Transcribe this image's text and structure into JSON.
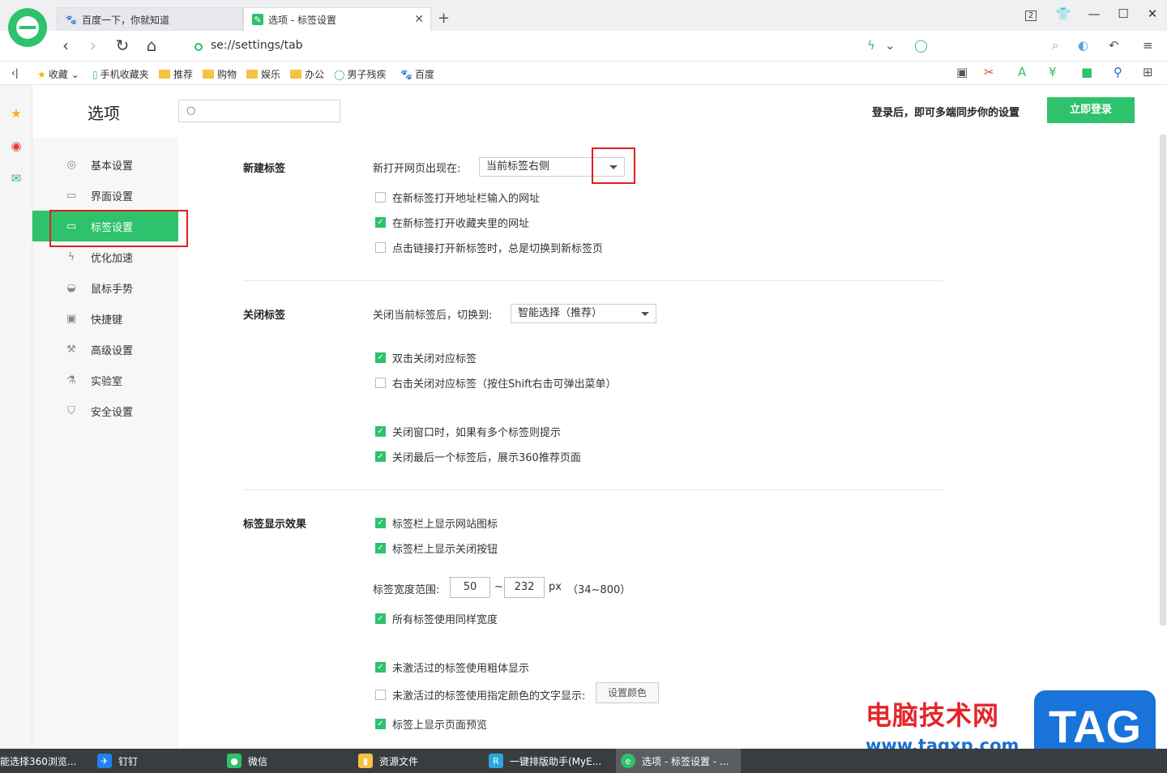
{
  "browser": {
    "tabs": [
      {
        "label": "百度一下，你就知道"
      },
      {
        "label": "选项 - 标签设置"
      }
    ],
    "tab_count": "2",
    "url": "se://settings/tab"
  },
  "bookmarks": {
    "items": [
      "收藏",
      "手机收藏夹",
      "推荐",
      "购物",
      "娱乐",
      "办公",
      "男子残疾",
      "百度"
    ]
  },
  "settings": {
    "title": "选项",
    "search_placeholder": "",
    "login_hint": "登录后，即可多端同步你的设置",
    "login_button": "立即登录",
    "nav": [
      {
        "label": "基本设置",
        "icon": "gear-icon"
      },
      {
        "label": "界面设置",
        "icon": "window-icon"
      },
      {
        "label": "标签设置",
        "icon": "tab-icon"
      },
      {
        "label": "优化加速",
        "icon": "lightning-icon"
      },
      {
        "label": "鼠标手势",
        "icon": "mouse-icon"
      },
      {
        "label": "快捷键",
        "icon": "keyboard-icon"
      },
      {
        "label": "高级设置",
        "icon": "wrench-icon"
      },
      {
        "label": "实验室",
        "icon": "flask-icon"
      },
      {
        "label": "安全设置",
        "icon": "shield-icon"
      }
    ],
    "active_nav": "标签设置",
    "new_tab": {
      "title": "新建标签",
      "open_label": "新打开网页出现在:",
      "open_value": "当前标签右侧",
      "options": [
        {
          "label": "在新标签打开地址栏输入的网址",
          "checked": false
        },
        {
          "label": "在新标签打开收藏夹里的网址",
          "checked": true
        },
        {
          "label": "点击链接打开新标签时，总是切换到新标签页",
          "checked": false
        }
      ]
    },
    "close_tab": {
      "title": "关闭标签",
      "switch_label": "关闭当前标签后，切换到:",
      "switch_value": "智能选择（推荐）",
      "options": [
        {
          "label": "双击关闭对应标签",
          "checked": true
        },
        {
          "label": "右击关闭对应标签（按住Shift右击可弹出菜单）",
          "checked": false
        },
        {
          "label": "关闭窗口时，如果有多个标签则提示",
          "checked": true
        },
        {
          "label": "关闭最后一个标签后，展示360推荐页面",
          "checked": true
        }
      ]
    },
    "display": {
      "title": "标签显示效果",
      "options_top": [
        {
          "label": "标签栏上显示网站图标",
          "checked": true
        },
        {
          "label": "标签栏上显示关闭按钮",
          "checked": true
        }
      ],
      "width_label": "标签宽度范围:",
      "width_min": "50",
      "width_sep": "~",
      "width_max": "232",
      "width_unit": "px",
      "width_range": "（34~800）",
      "same_width": {
        "label": "所有标签使用同样宽度",
        "checked": true
      },
      "options_bottom": [
        {
          "label": "未激活过的标签使用粗体显示",
          "checked": true
        },
        {
          "label": "未激活过的标签使用指定颜色的文字显示:",
          "checked": false
        },
        {
          "label": "标签上显示页面预览",
          "checked": true
        }
      ],
      "color_button": "设置颜色"
    }
  },
  "taskbar": {
    "items": [
      {
        "label": "能选择360浏览..."
      },
      {
        "label": "钉钉"
      },
      {
        "label": "微信"
      },
      {
        "label": "资源文件"
      },
      {
        "label": "一键排版助手(MyE..."
      },
      {
        "label": "选项 - 标签设置 - ..."
      }
    ]
  },
  "watermark": {
    "cn": "电脑技术网",
    "url": "www.tagxp.com",
    "tag": "TAG"
  },
  "colors": {
    "accent": "#2dc26b",
    "highlight_box": "#e02020"
  }
}
